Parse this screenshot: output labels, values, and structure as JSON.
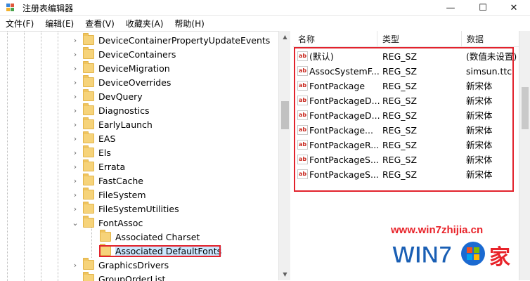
{
  "window": {
    "title": "注册表编辑器",
    "controls": {
      "minimize": "—",
      "maximize": "☐",
      "close": "✕"
    }
  },
  "menu": [
    "文件(F)",
    "编辑(E)",
    "查看(V)",
    "收藏夹(A)",
    "帮助(H)"
  ],
  "tree": {
    "items": [
      {
        "label": "DeviceContainerPropertyUpdateEvents",
        "expandable": true
      },
      {
        "label": "DeviceContainers",
        "expandable": true
      },
      {
        "label": "DeviceMigration",
        "expandable": true
      },
      {
        "label": "DeviceOverrides",
        "expandable": true
      },
      {
        "label": "DevQuery",
        "expandable": true
      },
      {
        "label": "Diagnostics",
        "expandable": true
      },
      {
        "label": "EarlyLaunch",
        "expandable": true
      },
      {
        "label": "EAS",
        "expandable": true
      },
      {
        "label": "Els",
        "expandable": true
      },
      {
        "label": "Errata",
        "expandable": true
      },
      {
        "label": "FastCache",
        "expandable": true
      },
      {
        "label": "FileSystem",
        "expandable": true
      },
      {
        "label": "FileSystemUtilities",
        "expandable": true
      },
      {
        "label": "FontAssoc",
        "expandable": true,
        "expanded": true
      },
      {
        "label": "Associated Charset",
        "child": true
      },
      {
        "label": "Associated DefaultFonts",
        "child": true,
        "selected": true
      },
      {
        "label": "GraphicsDrivers",
        "expandable": true
      },
      {
        "label": "GroupOrderList",
        "expandable": false
      }
    ]
  },
  "list": {
    "columns": [
      "名称",
      "类型",
      "数据"
    ],
    "rows": [
      {
        "name": "(默认)",
        "type": "REG_SZ",
        "data": "(数值未设置)"
      },
      {
        "name": "AssocSystemF...",
        "type": "REG_SZ",
        "data": "simsun.ttc"
      },
      {
        "name": "FontPackage",
        "type": "REG_SZ",
        "data": "新宋体"
      },
      {
        "name": "FontPackageD...",
        "type": "REG_SZ",
        "data": "新宋体"
      },
      {
        "name": "FontPackageD...",
        "type": "REG_SZ",
        "data": "新宋体"
      },
      {
        "name": "FontPackage...",
        "type": "REG_SZ",
        "data": "新宋体"
      },
      {
        "name": "FontPackageR...",
        "type": "REG_SZ",
        "data": "新宋体"
      },
      {
        "name": "FontPackageS...",
        "type": "REG_SZ",
        "data": "新宋体"
      },
      {
        "name": "FontPackageS...",
        "type": "REG_SZ",
        "data": "新宋体"
      }
    ],
    "string_icon_label": "ab"
  },
  "watermark": {
    "url": "www.win7zhijia.cn",
    "logo_text": "WIN7",
    "logo_suffix": "家"
  },
  "colors": {
    "highlight": "#e2222c",
    "folder": "#f6d37a",
    "selection": "#cce8ff"
  }
}
